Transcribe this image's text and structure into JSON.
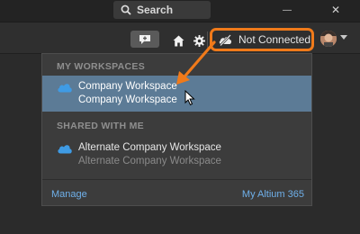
{
  "titlebar": {
    "search_placeholder": "Search",
    "close_glyph": "✕",
    "minimize_glyph": "—"
  },
  "toolbar": {
    "connection_status": "Not Connected"
  },
  "dropdown": {
    "my_workspaces_heading": "MY WORKSPACES",
    "my_workspaces": [
      {
        "name": "Company Workspace",
        "subtitle": "Company Workspace",
        "selected": true
      }
    ],
    "shared_heading": "SHARED WITH ME",
    "shared_workspaces": [
      {
        "name": "Alternate Company Workspace",
        "subtitle": "Alternate Company Workspace",
        "selected": false
      }
    ],
    "manage_link": "Manage",
    "my_altium_link": "My Altium 365"
  },
  "colors": {
    "accent_orange": "#f07a1a",
    "selection": "#5c7b96",
    "link": "#6fb0ea",
    "cloud": "#3f9be4"
  },
  "icons": [
    "search-icon",
    "minimize-icon",
    "close-icon",
    "chat-add-icon",
    "home-icon",
    "gear-icon",
    "cloud-off-icon",
    "user-avatar-icon",
    "chevron-down-icon",
    "cloud-icon",
    "mouse-cursor-icon",
    "callout-arrow"
  ]
}
